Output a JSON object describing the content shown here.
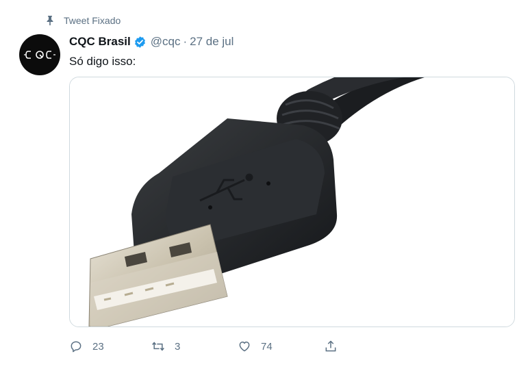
{
  "pinned": {
    "label": "Tweet Fixado",
    "icon": "pin-icon"
  },
  "author": {
    "name": "CQC Brasil",
    "handle": "@cqc",
    "separator": "·",
    "date": "27 de jul",
    "verified_icon": "verified-badge-icon",
    "avatar_icon": "cqc-logo"
  },
  "tweet": {
    "text": "Só digo isso:"
  },
  "media": {
    "description_icon": "usb-cable-photo"
  },
  "actions": {
    "reply": {
      "icon": "reply-icon",
      "count": "23"
    },
    "retweet": {
      "icon": "retweet-icon",
      "count": "3"
    },
    "like": {
      "icon": "like-icon",
      "count": "74"
    },
    "share": {
      "icon": "share-icon"
    }
  },
  "colors": {
    "text": "#0f1419",
    "secondary": "#5b7083",
    "verified": "#1d9bf0",
    "border": "#cfd9de"
  }
}
